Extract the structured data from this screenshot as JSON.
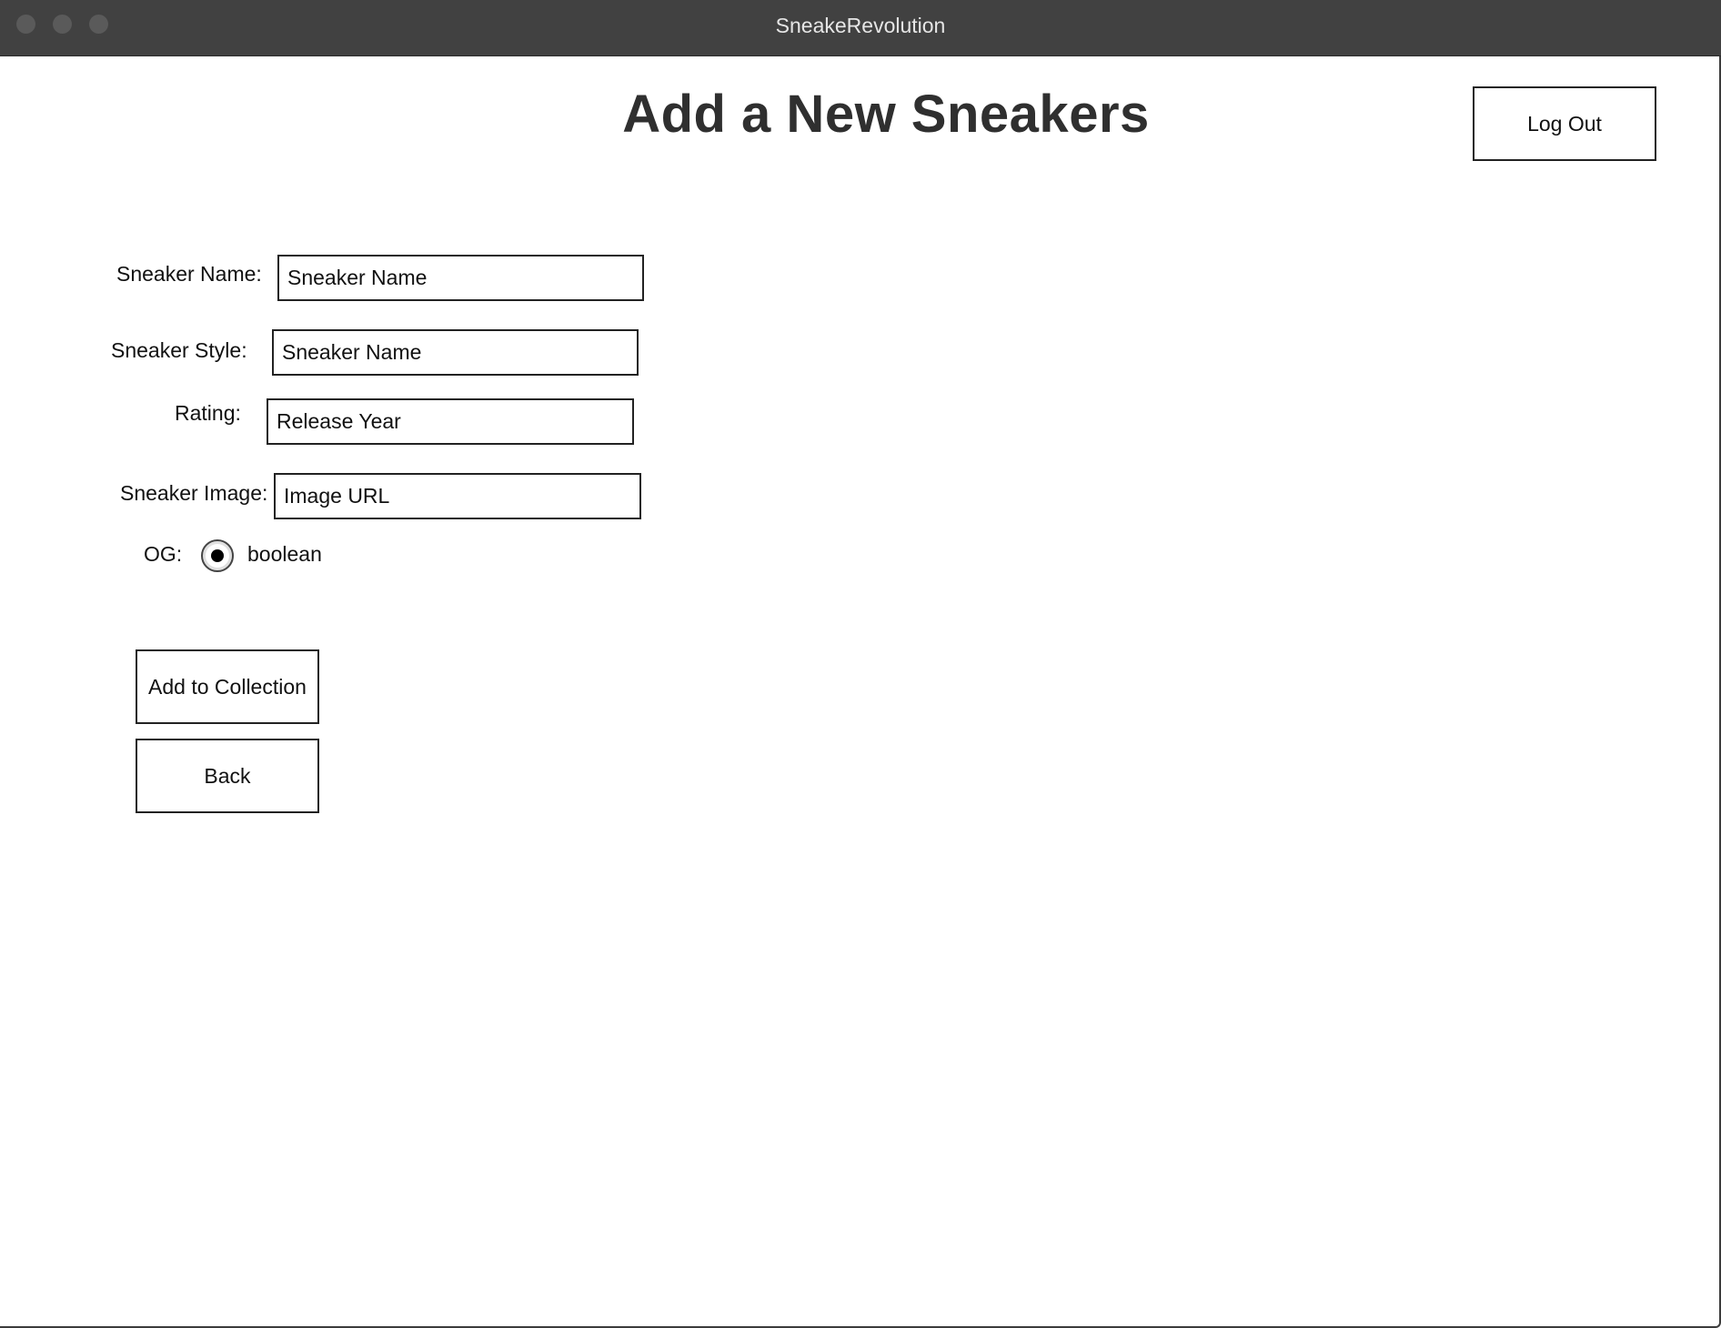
{
  "window": {
    "title": "SneakeRevolution"
  },
  "header": {
    "page_title": "Add a New Sneakers",
    "logout_label": "Log Out"
  },
  "form": {
    "sneaker_name": {
      "label": "Sneaker Name:",
      "value": "Sneaker Name"
    },
    "sneaker_style": {
      "label": "Sneaker Style:",
      "value": "Sneaker Name"
    },
    "rating": {
      "label": "Rating:",
      "value": "Release Year"
    },
    "sneaker_image": {
      "label": "Sneaker Image:",
      "value": "Image URL"
    },
    "og": {
      "label": "OG:",
      "option_label": "boolean",
      "selected": true
    }
  },
  "actions": {
    "add_label": "Add to Collection",
    "back_label": "Back"
  }
}
